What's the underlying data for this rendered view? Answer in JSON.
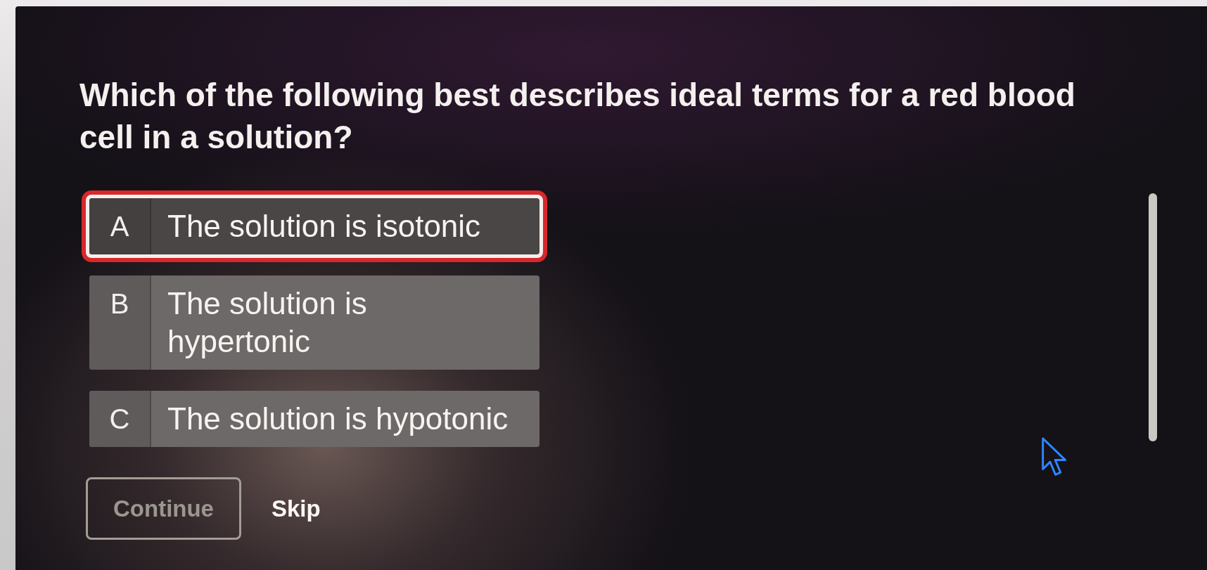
{
  "question": {
    "text": "Which of the following best describes ideal terms for a red blood cell in a solution?"
  },
  "options": [
    {
      "letter": "A",
      "text": "The solution is isotonic",
      "selected": true
    },
    {
      "letter": "B",
      "text": "The solution is hypertonic",
      "selected": false
    },
    {
      "letter": "C",
      "text": "The solution is hypotonic",
      "selected": false
    }
  ],
  "actions": [
    {
      "kind": "outlined",
      "label": "Continue",
      "disabled": true
    },
    {
      "kind": "link",
      "label": "Skip",
      "disabled": false
    }
  ]
}
